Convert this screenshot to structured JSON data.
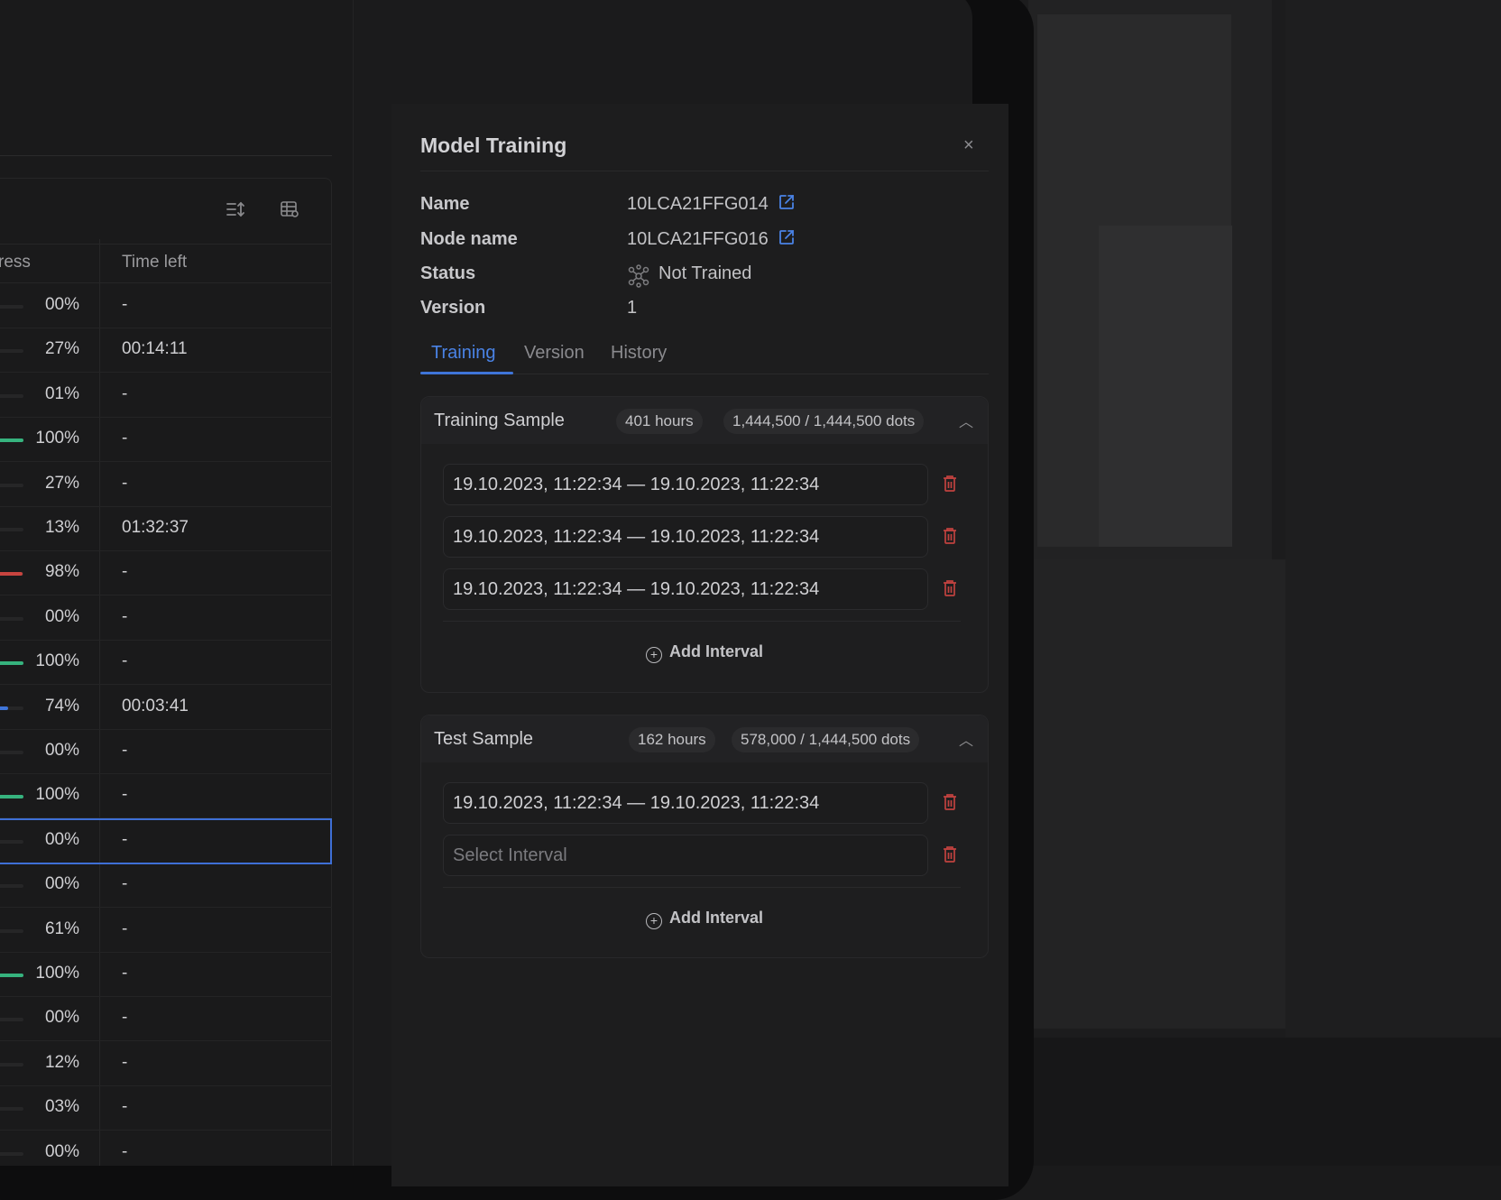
{
  "table": {
    "headers": {
      "progress": "progress",
      "time_left": "Time left"
    },
    "rows": [
      {
        "percent": "00%",
        "value": 0,
        "time_left": "-",
        "color": "#2a2a2b"
      },
      {
        "percent": "27%",
        "value": 27,
        "time_left": "00:14:11",
        "color": "#2a2a2b"
      },
      {
        "percent": "01%",
        "value": 1,
        "time_left": "-",
        "color": "#2a2a2b"
      },
      {
        "percent": "100%",
        "value": 100,
        "time_left": "-",
        "color": "#36b37e"
      },
      {
        "percent": "27%",
        "value": 27,
        "time_left": "-",
        "color": "#2a2a2b"
      },
      {
        "percent": "13%",
        "value": 13,
        "time_left": "01:32:37",
        "color": "#2a2a2b"
      },
      {
        "percent": "98%",
        "value": 98,
        "time_left": "-",
        "color": "#c8443f"
      },
      {
        "percent": "00%",
        "value": 0,
        "time_left": "-",
        "color": "#2a2a2b"
      },
      {
        "percent": "100%",
        "value": 100,
        "time_left": "-",
        "color": "#36b37e"
      },
      {
        "percent": "74%",
        "value": 74,
        "time_left": "00:03:41",
        "color": "#3f75d9"
      },
      {
        "percent": "00%",
        "value": 0,
        "time_left": "-",
        "color": "#2a2a2b"
      },
      {
        "percent": "100%",
        "value": 100,
        "time_left": "-",
        "color": "#36b37e"
      },
      {
        "percent": "00%",
        "value": 0,
        "time_left": "-",
        "color": "#2a2a2b",
        "selected": true
      },
      {
        "percent": "00%",
        "value": 0,
        "time_left": "-",
        "color": "#2a2a2b"
      },
      {
        "percent": "61%",
        "value": 61,
        "time_left": "-",
        "color": "#2a2a2b"
      },
      {
        "percent": "100%",
        "value": 100,
        "time_left": "-",
        "color": "#36b37e"
      },
      {
        "percent": "00%",
        "value": 0,
        "time_left": "-",
        "color": "#2a2a2b"
      },
      {
        "percent": "12%",
        "value": 12,
        "time_left": "-",
        "color": "#2a2a2b"
      },
      {
        "percent": "03%",
        "value": 3,
        "time_left": "-",
        "color": "#2a2a2b"
      },
      {
        "percent": "00%",
        "value": 0,
        "time_left": "-",
        "color": "#2a2a2b"
      }
    ]
  },
  "drawer": {
    "title": "Model Training",
    "close": "×",
    "props": {
      "name_label": "Name",
      "name_value": "10LCA21FFG014",
      "node_label": "Node name",
      "node_value": "10LCA21FFG016",
      "status_label": "Status",
      "status_value": "Not Trained",
      "version_label": "Version",
      "version_value": "1"
    },
    "tabs": [
      "Training",
      "Version",
      "History"
    ],
    "training_sample": {
      "title": "Training Sample",
      "hours": "401 hours",
      "dots": "1,444,500 / 1,444,500 dots",
      "intervals": [
        "19.10.2023, 11:22:34 — 19.10.2023, 11:22:34",
        "19.10.2023, 11:22:34 — 19.10.2023, 11:22:34",
        "19.10.2023, 11:22:34 — 19.10.2023, 11:22:34"
      ],
      "add_label": "Add Interval"
    },
    "test_sample": {
      "title": "Test Sample",
      "hours": "162 hours",
      "dots": "578,000 / 1,444,500 dots",
      "intervals": [
        "19.10.2023, 11:22:34 — 19.10.2023, 11:22:34"
      ],
      "placeholder": "Select Interval",
      "add_label": "Add Interval"
    }
  },
  "colors": {
    "accent": "#3f75d9",
    "success": "#36b37e",
    "danger": "#c8443f"
  }
}
